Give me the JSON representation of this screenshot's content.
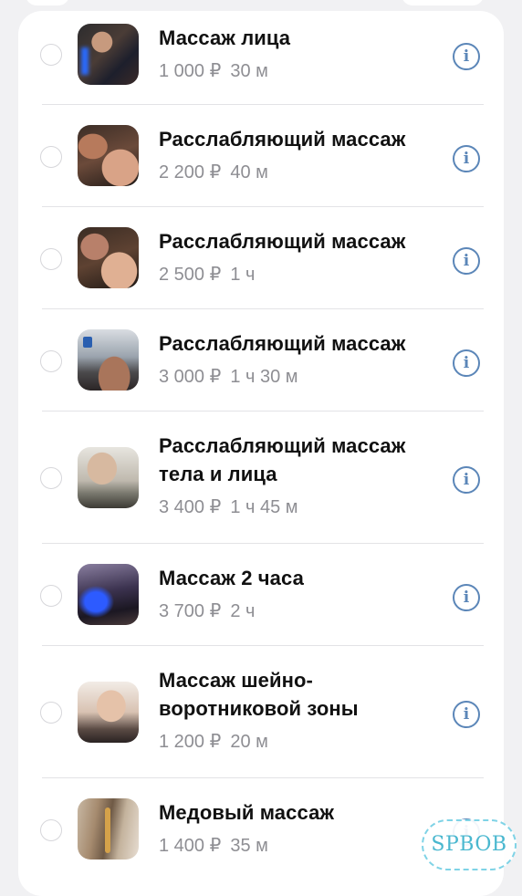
{
  "services": [
    {
      "title_lines": [
        "Массаж лица"
      ],
      "price": "1 000 ₽",
      "duration": "30 м",
      "thumb_icon": "face-massage-photo"
    },
    {
      "title_lines": [
        "Расслабляющий массаж"
      ],
      "price": "2 200 ₽",
      "duration": "40 м",
      "thumb_icon": "back-massage-photo"
    },
    {
      "title_lines": [
        "Расслабляющий массаж"
      ],
      "price": "2 500 ₽",
      "duration": "1 ч",
      "thumb_icon": "back-massage-photo"
    },
    {
      "title_lines": [
        "Расслабляющий массаж"
      ],
      "price": "3 000 ₽",
      "duration": "1 ч 30 м",
      "thumb_icon": "massage-table-photo"
    },
    {
      "title_lines": [
        "Расслабляющий массаж",
        "тела и лица"
      ],
      "price": "3 400 ₽",
      "duration": "1 ч 45 м",
      "thumb_icon": "shoulder-photo"
    },
    {
      "title_lines": [
        "Массаж 2 часа"
      ],
      "price": "3 700 ₽",
      "duration": "2 ч",
      "thumb_icon": "massage-room-photo"
    },
    {
      "title_lines": [
        "Массаж шейно-",
        "воротниковой зоны"
      ],
      "price": "1 200 ₽",
      "duration": "20 м",
      "thumb_icon": "neck-massage-photo"
    },
    {
      "title_lines": [
        "Медовый массаж"
      ],
      "price": "1 400 ₽",
      "duration": "35 м",
      "thumb_icon": "honey-massage-photo"
    }
  ],
  "info_glyph": "i",
  "watermark": "SPBOB",
  "colors": {
    "accent": "#5b86b8",
    "secondary_text": "#8e8e93",
    "background": "#f1f1f3"
  }
}
